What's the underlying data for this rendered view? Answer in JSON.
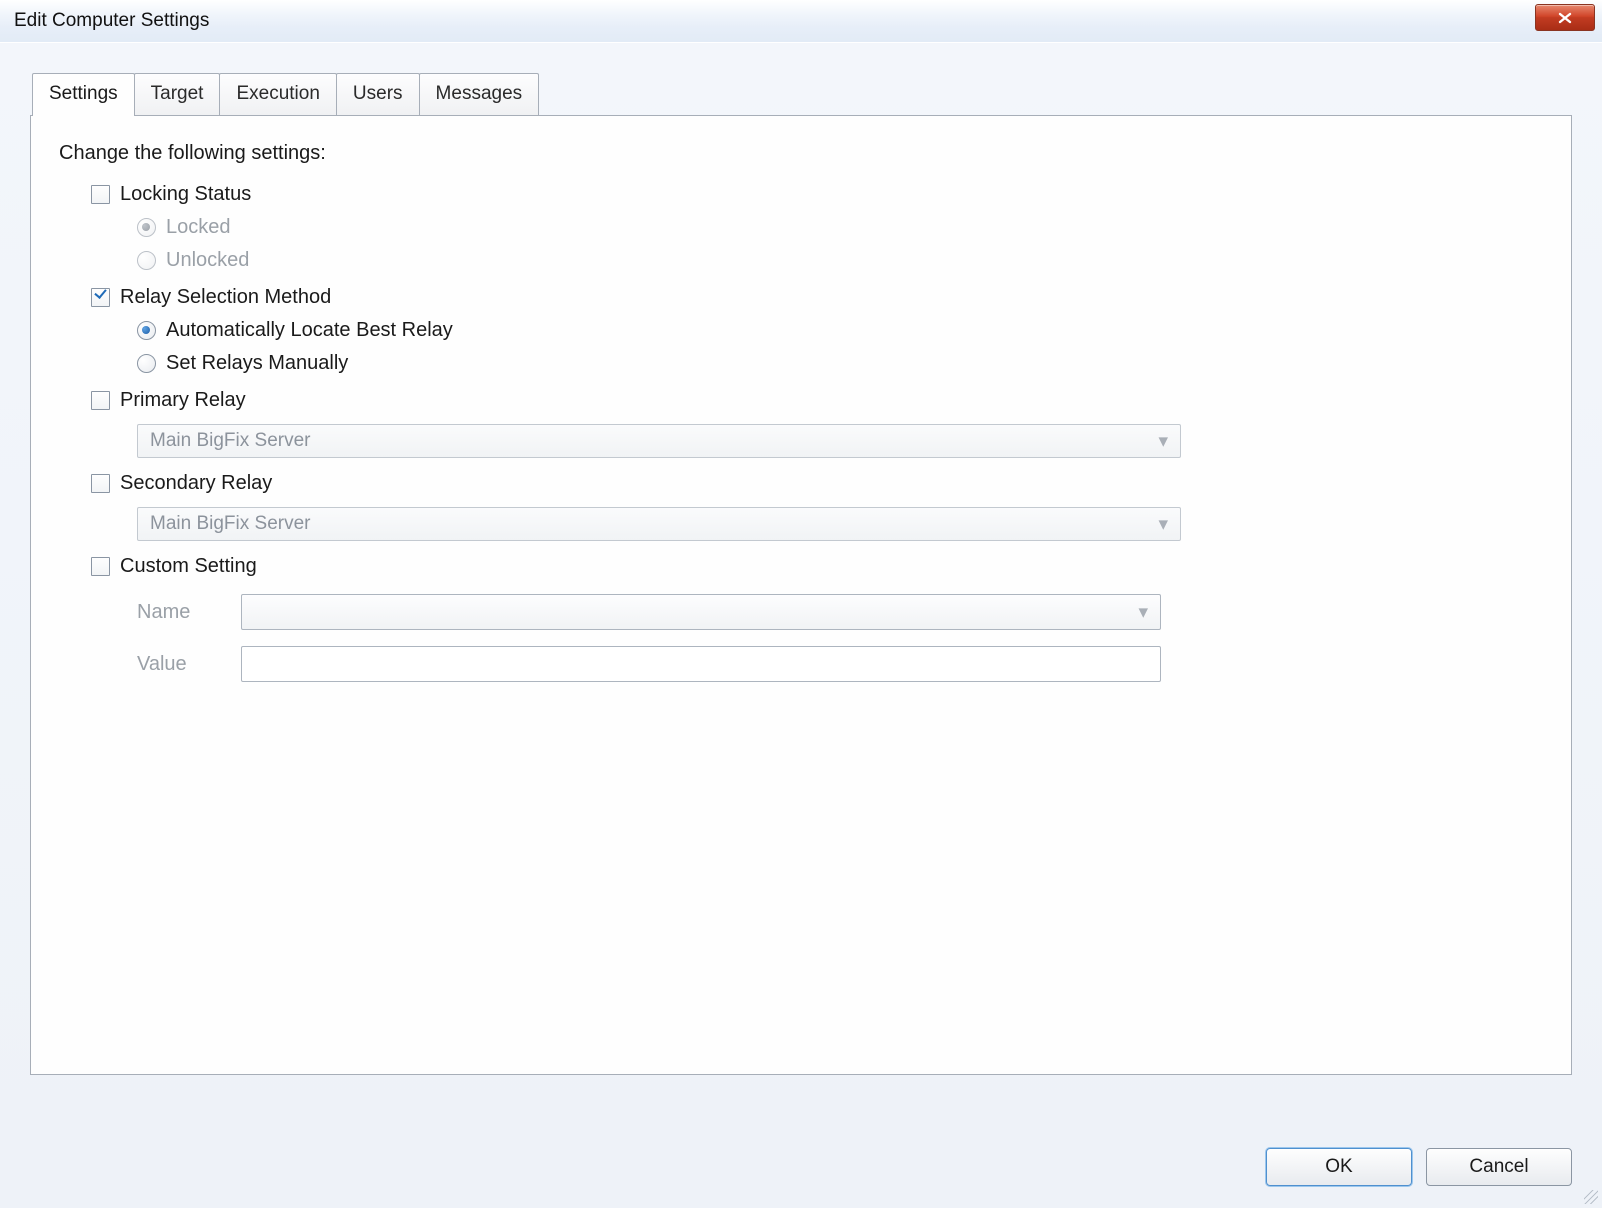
{
  "window": {
    "title": "Edit Computer Settings"
  },
  "tabs": [
    {
      "label": "Settings",
      "active": true
    },
    {
      "label": "Target",
      "active": false
    },
    {
      "label": "Execution",
      "active": false
    },
    {
      "label": "Users",
      "active": false
    },
    {
      "label": "Messages",
      "active": false
    }
  ],
  "settings": {
    "heading": "Change the following settings:",
    "locking_status": {
      "label": "Locking Status",
      "checked": false,
      "options": {
        "locked": {
          "label": "Locked",
          "selected": true
        },
        "unlocked": {
          "label": "Unlocked",
          "selected": false
        }
      }
    },
    "relay_method": {
      "label": "Relay Selection Method",
      "checked": true,
      "options": {
        "auto": {
          "label": "Automatically Locate Best Relay",
          "selected": true
        },
        "manual": {
          "label": "Set Relays Manually",
          "selected": false
        }
      }
    },
    "primary_relay": {
      "label": "Primary Relay",
      "checked": false,
      "value": "Main BigFix Server"
    },
    "secondary_relay": {
      "label": "Secondary Relay",
      "checked": false,
      "value": "Main BigFix Server"
    },
    "custom_setting": {
      "label": "Custom Setting",
      "checked": false,
      "name_label": "Name",
      "name_value": "",
      "value_label": "Value",
      "value_value": ""
    }
  },
  "buttons": {
    "ok": "OK",
    "cancel": "Cancel"
  }
}
